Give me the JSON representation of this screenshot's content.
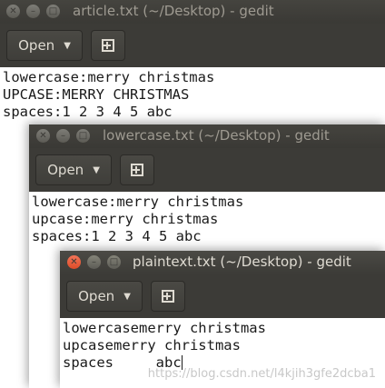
{
  "windows": [
    {
      "title": "article.txt (~/Desktop) - gedit",
      "open_label": "Open",
      "lines": [
        "lowercase:merry christmas",
        "UPCASE:MERRY CHRISTMAS",
        "spaces:1 2 3 4 5 abc"
      ]
    },
    {
      "title": "lowercase.txt (~/Desktop) - gedit",
      "open_label": "Open",
      "lines": [
        "lowercase:merry christmas",
        "upcase:merry christmas",
        "spaces:1 2 3 4 5 abc"
      ]
    },
    {
      "title": "plaintext.txt (~/Desktop) - gedit",
      "open_label": "Open",
      "lines": [
        "lowercasemerry christmas",
        "upcasemerry christmas",
        "spaces     abc"
      ]
    }
  ],
  "watermark": "https://blog.csdn.net/l4kjih3gfe2dcba1",
  "icons": {
    "close": "close-icon",
    "minimize": "minimize-icon",
    "maximize": "maximize-icon",
    "new_document": "new-document-icon",
    "dropdown": "chevron-down-icon"
  }
}
